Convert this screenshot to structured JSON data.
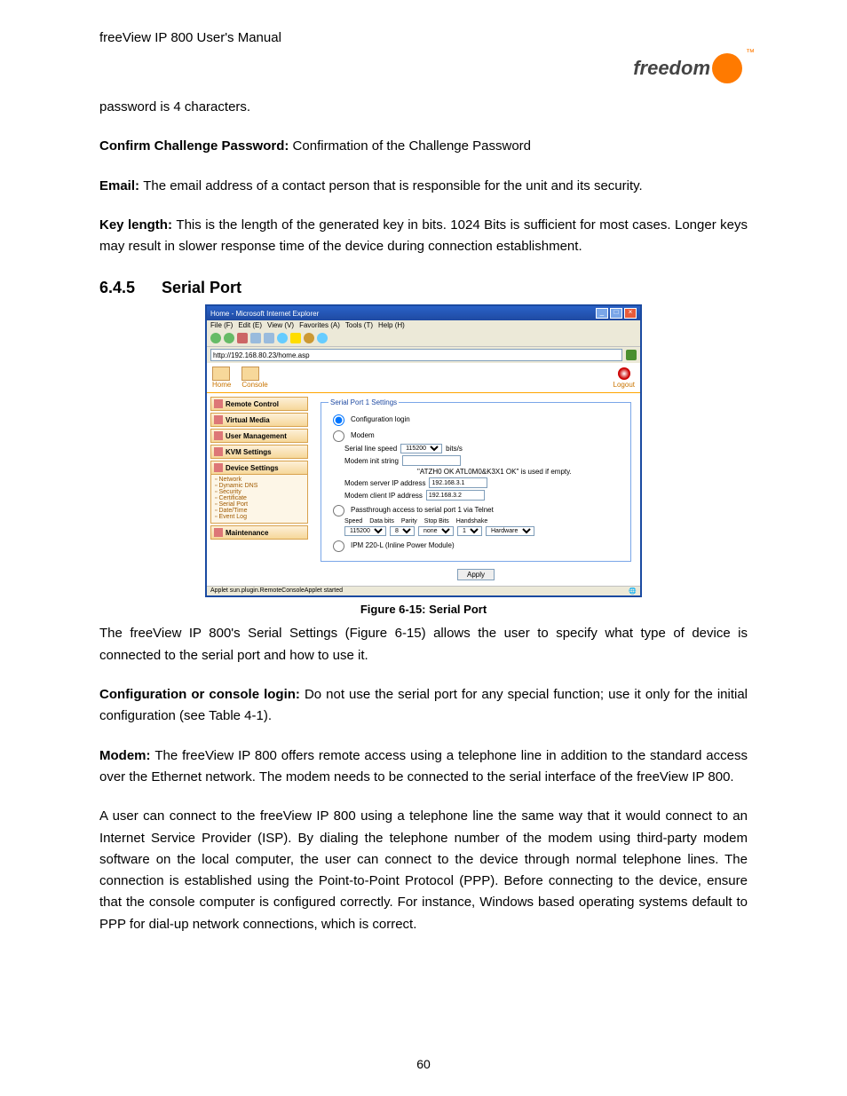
{
  "doc": {
    "headerLine": "freeView IP 800 User's Manual",
    "logoText": "freedom",
    "pwLine": "password is 4 characters.",
    "confirmLabel": "Confirm Challenge Password: ",
    "confirmBody": "Confirmation of the Challenge Password",
    "emailLabel": "Email: ",
    "emailBody": "The email address of a contact person that is responsible for the unit and its security.",
    "keyLabel": "Key length: ",
    "keyBody": "This is the length of the generated key in bits. 1024 Bits is sufficient for most cases. Longer keys may result in slower response time of the device during connection establishment.",
    "sectionNum": "6.4.5",
    "sectionTitle": "Serial Port",
    "figureCaption": "Figure 6-15: Serial Port",
    "para1": "The freeView IP 800's Serial Settings (Figure 6-15) allows the user to specify what type of device is connected to the serial port and how to use it.",
    "cfgLabel": "Configuration or console login: ",
    "cfgBody": "Do not use the serial port for any special function; use it only for the initial configuration (see Table 4-1).",
    "modemLabel": "Modem: ",
    "modemBody": "The freeView IP 800 offers remote access using a telephone line in addition to the standard access over the Ethernet network. The modem needs to be connected to the serial interface of the freeView IP 800.",
    "para2": "A user can connect to the freeView IP 800 using a telephone line the same way that it would connect to an Internet Service Provider (ISP). By dialing the telephone number of the modem using third-party modem software on the local computer, the user can connect to the device through normal telephone lines. The connection is established using the Point-to-Point Protocol (PPP). Before connecting to the device, ensure that the console computer is configured correctly. For instance, Windows based operating systems default to PPP for dial-up network connections, which is correct.",
    "pageNumber": "60"
  },
  "shot": {
    "windowTitle": "Home - Microsoft Internet Explorer",
    "menus": [
      "File (F)",
      "Edit (E)",
      "View (V)",
      "Favorites (A)",
      "Tools (T)",
      "Help (H)"
    ],
    "url": "http://192.168.80.23/home.asp",
    "top": {
      "home": "Home",
      "console": "Console",
      "logout": "Logout"
    },
    "sidebar": {
      "items": [
        "Remote Control",
        "Virtual Media",
        "User Management",
        "KVM Settings",
        "Device Settings"
      ],
      "sub": [
        "Network",
        "Dynamic DNS",
        "Security",
        "Certificate",
        "Serial Port",
        "Date/Time",
        "Event Log"
      ],
      "last": "Maintenance"
    },
    "panel": {
      "legend": "Serial Port 1 Settings",
      "optConfig": "Configuration login",
      "optModem": "Modem",
      "lineSpeedLabel": "Serial line speed",
      "lineSpeedVal": "115200",
      "lineSpeedUnit": "bits/s",
      "initLabel": "Modem init string",
      "initHint": "\"ATZH0 OK ATL0M0&K3X1 OK\" is used if empty.",
      "serverLabel": "Modem server IP address",
      "serverVal": "192.168.3.1",
      "clientLabel": "Modem client IP address",
      "clientVal": "192.168.3.2",
      "optPass": "Passthrough access to serial port 1 via Telnet",
      "hdr": [
        "Speed",
        "Data bits",
        "Parity",
        "Stop Bits",
        "Handshake"
      ],
      "vals": [
        "115200",
        "8",
        "none",
        "1",
        "Hardware"
      ],
      "optIPM": "IPM 220-L (Inline Power Module)",
      "apply": "Apply"
    },
    "status": "Applet sun.plugin.RemoteConsoleApplet started"
  }
}
